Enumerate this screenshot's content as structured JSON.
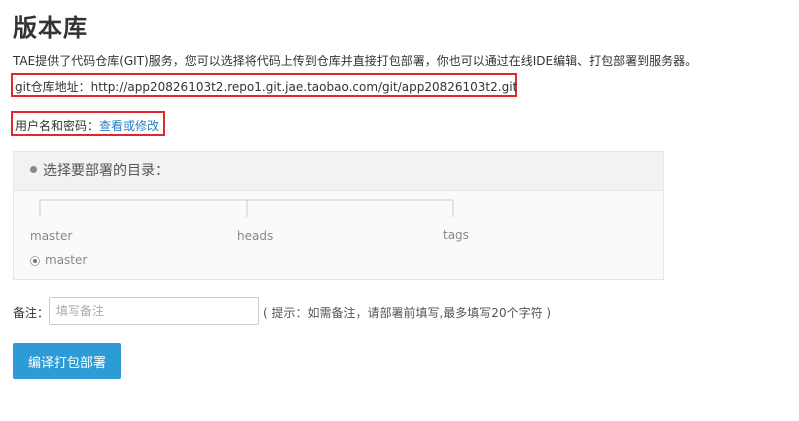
{
  "page": {
    "title": "版本库",
    "description": "TAE提供了代码仓库(GIT)服务，您可以选择将代码上传到仓库并直接打包部署，你也可以通过在线IDE编辑、打包部署到服务器。"
  },
  "git": {
    "label": "git仓库地址：",
    "url": "http://app20826103t2.repo1.git.jae.taobao.com/git/app20826103t2.git"
  },
  "credentials": {
    "label": "用户名和密码：",
    "link_text": "查看或修改"
  },
  "directory": {
    "title": "选择要部署的目录：",
    "tree": [
      "master",
      "heads",
      "tags"
    ],
    "options": [
      {
        "label": "master",
        "selected": true
      }
    ]
  },
  "remark": {
    "label": "备注：",
    "placeholder": "填写备注",
    "value": "",
    "hint": "( 提示：如需备注，请部署前填写,最多填写20个字符 )"
  },
  "actions": {
    "deploy_label": "编译打包部署"
  },
  "colors": {
    "highlight_border": "#e0282e",
    "link": "#2a7fc1",
    "primary_button": "#2d9bd6"
  }
}
